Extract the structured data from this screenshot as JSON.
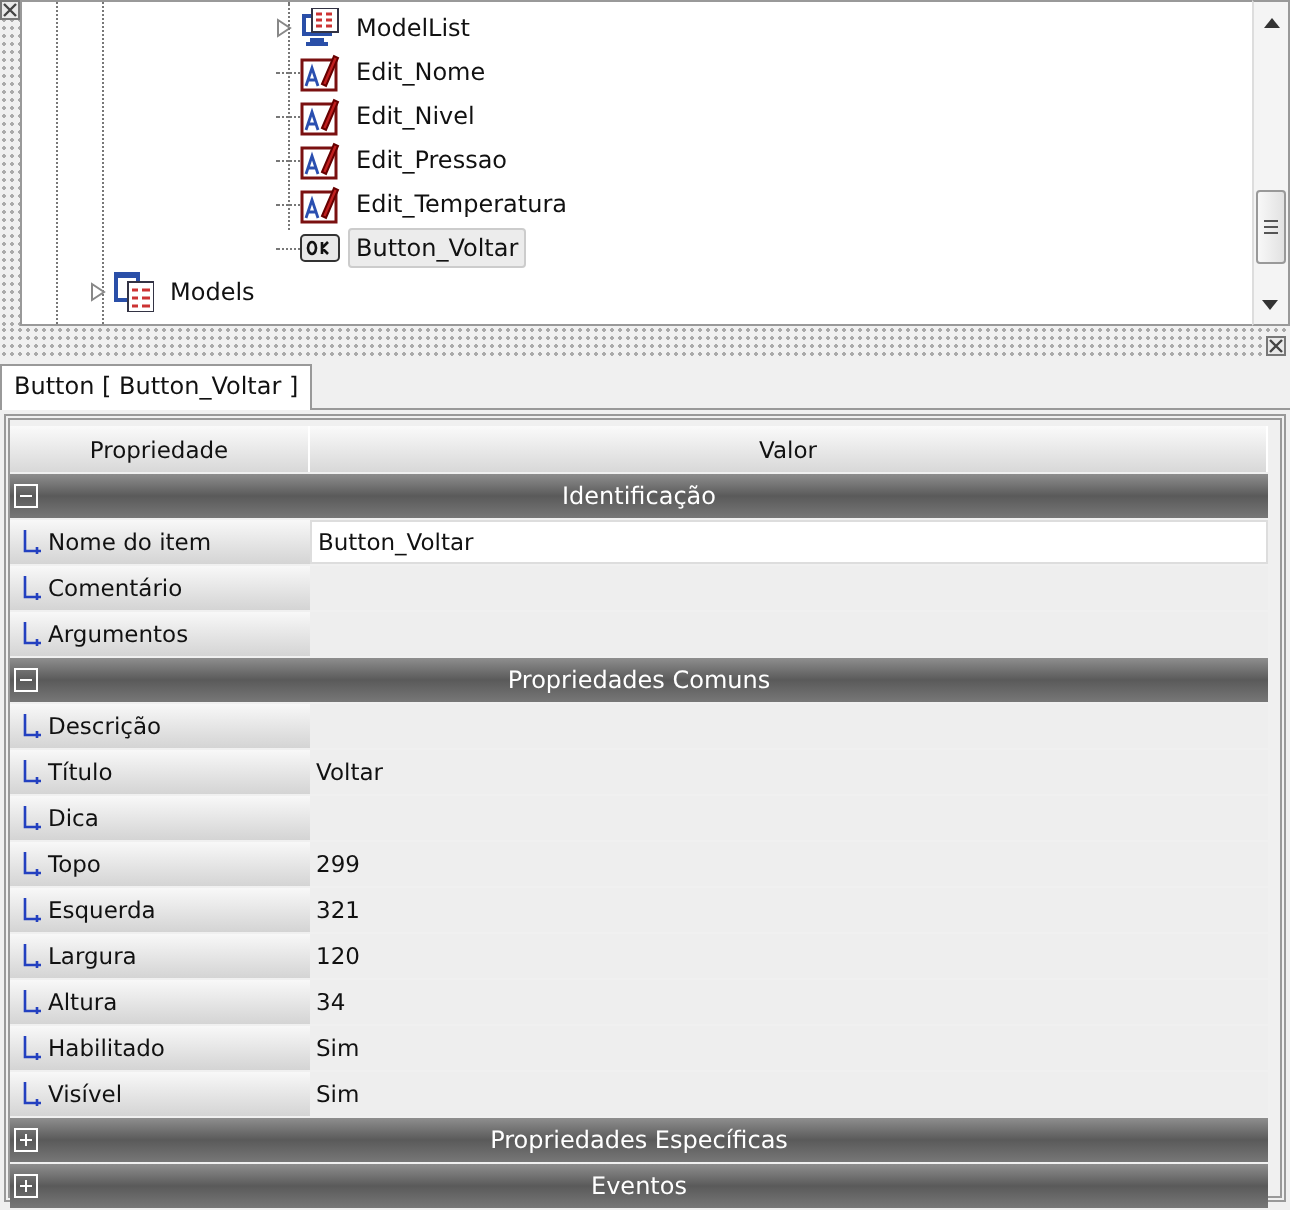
{
  "tree": {
    "items": [
      {
        "children": [
          {
            "children": [
              {
                "label": "ModelList",
                "kind": "list",
                "expandable": true,
                "selected": false
              },
              {
                "label": "Edit_Nome",
                "kind": "edit",
                "expandable": false,
                "selected": false
              },
              {
                "label": "Edit_Nivel",
                "kind": "edit",
                "expandable": false,
                "selected": false
              },
              {
                "label": "Edit_Pressao",
                "kind": "edit",
                "expandable": false,
                "selected": false
              },
              {
                "label": "Edit_Temperatura",
                "kind": "edit",
                "expandable": false,
                "selected": false
              },
              {
                "label": "Button_Voltar",
                "kind": "button",
                "expandable": false,
                "selected": true
              }
            ]
          }
        ]
      },
      {
        "label": "Models",
        "kind": "models",
        "expandable": true,
        "selected": false
      }
    ]
  },
  "tab": {
    "label": "Button [ Button_Voltar ]",
    "selected": true
  },
  "grid": {
    "columns": [
      "Propriedade",
      "Valor"
    ],
    "rows": [
      {
        "kind": "group",
        "label": "Identificação",
        "expanded": true
      },
      {
        "kind": "property",
        "name": "Nome do item",
        "value": "Button_Voltar",
        "selected": true
      },
      {
        "kind": "property",
        "name": "Comentário",
        "selected": false
      },
      {
        "kind": "property",
        "name": "Argumentos",
        "selected": false
      },
      {
        "kind": "group",
        "label": "Propriedades Comuns",
        "expanded": true
      },
      {
        "kind": "property",
        "name": "Descrição",
        "selected": false
      },
      {
        "kind": "property",
        "name": "Título",
        "value": "Voltar",
        "selected": false
      },
      {
        "kind": "property",
        "name": "Dica",
        "selected": false
      },
      {
        "kind": "property",
        "name": "Topo",
        "value": "299",
        "selected": false
      },
      {
        "kind": "property",
        "name": "Esquerda",
        "value": "321",
        "selected": false
      },
      {
        "kind": "property",
        "name": "Largura",
        "value": "120",
        "selected": false
      },
      {
        "kind": "property",
        "name": "Altura",
        "value": "34",
        "selected": false
      },
      {
        "kind": "property",
        "name": "Habilitado",
        "value": "Sim",
        "selected": false
      },
      {
        "kind": "property",
        "name": "Visível",
        "value": "Sim",
        "selected": false
      },
      {
        "kind": "group",
        "label": "Propriedades Específicas",
        "expanded": false
      },
      {
        "kind": "group",
        "label": "Eventos",
        "expanded": false
      }
    ]
  }
}
